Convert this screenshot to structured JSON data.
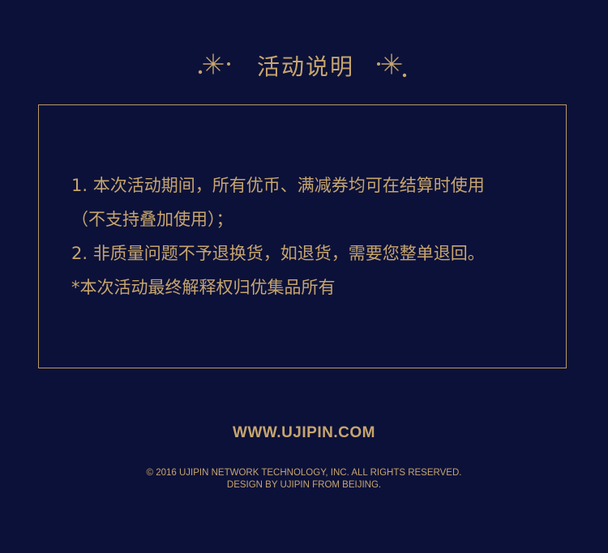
{
  "header": {
    "title": "活动说明",
    "left_icon": "sparkle-icon",
    "right_icon": "sparkle-icon"
  },
  "notice": {
    "lines": [
      "1. 本次活动期间，所有优币、满减券均可在结算时使用",
      "（不支持叠加使用）；",
      "2. 非质量问题不予退换货，如退货，需要您整单退回。",
      "*本次活动最终解释权归优集品所有"
    ]
  },
  "footer": {
    "url": "WWW.UJIPIN.COM",
    "copyright_line1": "© 2016 UJIPIN NETWORK TECHNOLOGY, INC.  ALL RIGHTS RESERVED.",
    "copyright_line2": "DESIGN BY UJIPIN FROM BEIJING."
  },
  "colors": {
    "background": "#0c1139",
    "accent_gold": "#c6a56e",
    "border_gold": "#b89a62"
  }
}
